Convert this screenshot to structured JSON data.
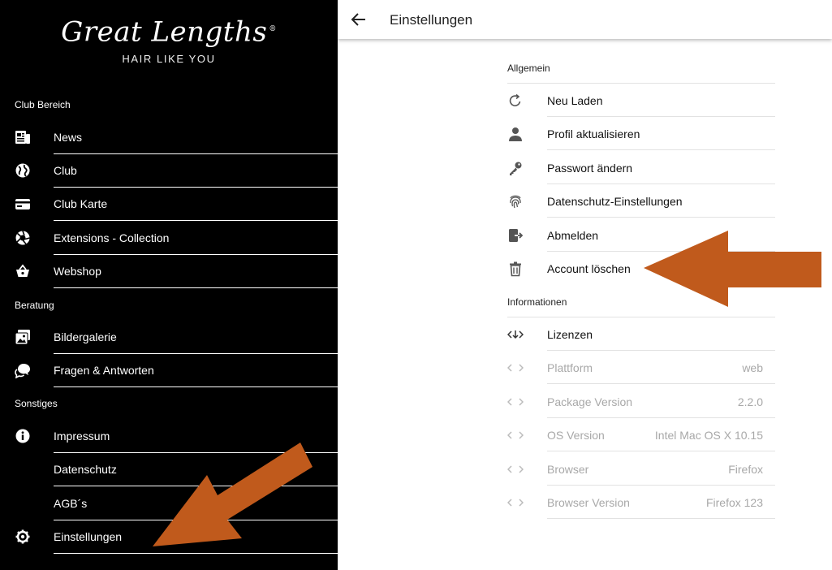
{
  "sidebar": {
    "logo": {
      "wordmark": "Great Lengths",
      "registered": "®",
      "tagline": "HAIR LIKE YOU"
    },
    "sections": {
      "club": "Club Bereich",
      "beratung": "Beratung",
      "sonstiges": "Sonstiges"
    },
    "items": {
      "news": "News",
      "club": "Club",
      "club_karte": "Club Karte",
      "extensions": "Extensions - Collection",
      "webshop": "Webshop",
      "bildergalerie": "Bildergalerie",
      "fragen": "Fragen & Antworten",
      "impressum": "Impressum",
      "datenschutz": "Datenschutz",
      "agb": "AGB´s",
      "einstellungen": "Einstellungen"
    }
  },
  "header": {
    "title": "Einstellungen"
  },
  "settings": {
    "general": {
      "label": "Allgemein",
      "items": {
        "reload": "Neu Laden",
        "profile": "Profil aktualisieren",
        "password": "Passwort ändern",
        "privacy": "Datenschutz-Einstellungen",
        "logout": "Abmelden",
        "delete": "Account löschen"
      }
    },
    "info": {
      "label": "Informationen",
      "licenses": "Lizenzen",
      "platform": {
        "label": "Plattform",
        "value": "web"
      },
      "package": {
        "label": "Package Version",
        "value": "2.2.0"
      },
      "os": {
        "label": "OS Version",
        "value": "Intel Mac OS X 10.15"
      },
      "browser": {
        "label": "Browser",
        "value": "Firefox"
      },
      "browser_version": {
        "label": "Browser Version",
        "value": "Firefox 123"
      }
    }
  },
  "colors": {
    "arrow": "#c05a1c",
    "sidebar_bg": "#000000",
    "muted_text": "#a8a8a8"
  }
}
